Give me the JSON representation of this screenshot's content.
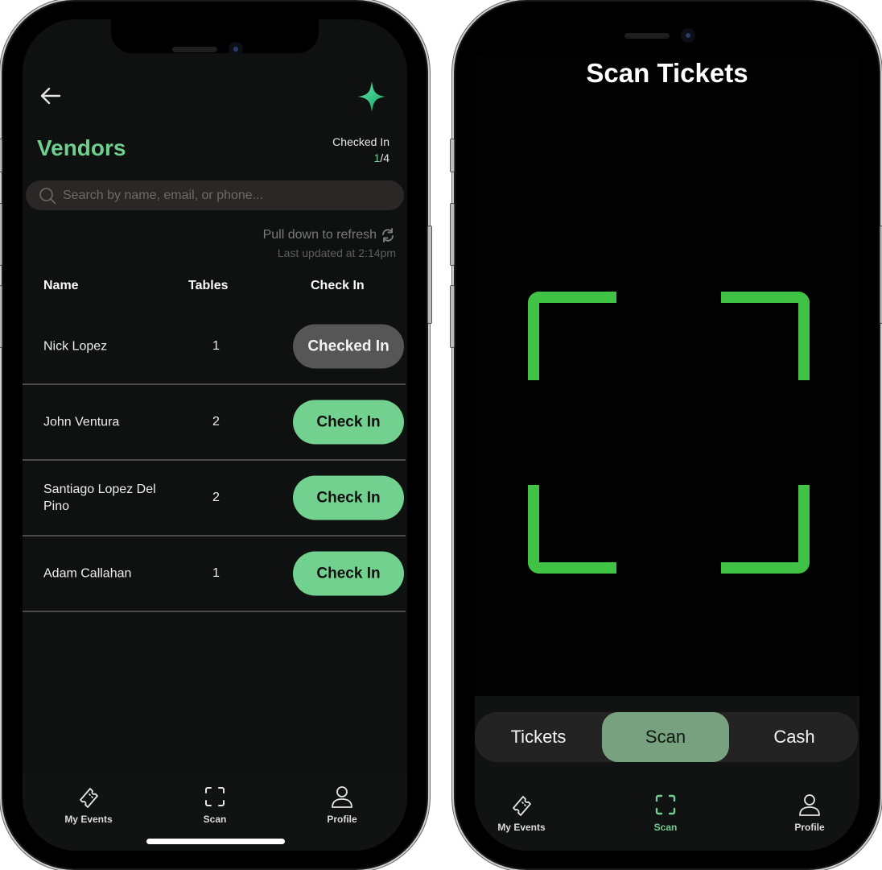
{
  "colors": {
    "accent_green": "#6fcf8f",
    "checkin_button": "#72d18e",
    "checked_in_button": "#565656",
    "scan_frame": "#40c244",
    "segment_active": "#78a17f"
  },
  "vendors_screen": {
    "back_icon": "arrow-left-icon",
    "brand_icon": "sparkle-icon",
    "title": "Vendors",
    "checked_in_label": "Checked In",
    "checked_in_count": "1",
    "checked_in_total": "/4",
    "search": {
      "placeholder": "Search by name, email, or phone...",
      "value": ""
    },
    "refresh_hint": "Pull down to refresh",
    "last_updated": "Last updated at 2:14pm",
    "table": {
      "columns": [
        "Name",
        "Tables",
        "Check In"
      ],
      "rows": [
        {
          "name": "Nick Lopez",
          "tables": "1",
          "action": "Checked In",
          "checked_in": true
        },
        {
          "name": "John Ventura",
          "tables": "2",
          "action": "Check In",
          "checked_in": false
        },
        {
          "name": "Santiago Lopez Del Pino",
          "tables": "2",
          "action": "Check In",
          "checked_in": false
        },
        {
          "name": "Adam Callahan",
          "tables": "1",
          "action": "Check In",
          "checked_in": false
        }
      ]
    },
    "tabbar": [
      {
        "label": "My Events",
        "icon": "ticket-icon",
        "active": false
      },
      {
        "label": "Scan",
        "icon": "scan-icon",
        "active": false
      },
      {
        "label": "Profile",
        "icon": "person-icon",
        "active": false
      }
    ]
  },
  "scan_screen": {
    "title": "Scan Tickets",
    "segments": [
      {
        "label": "Tickets",
        "active": false
      },
      {
        "label": "Scan",
        "active": true
      },
      {
        "label": "Cash",
        "active": false
      }
    ],
    "tabbar": [
      {
        "label": "My Events",
        "icon": "ticket-icon",
        "active": false
      },
      {
        "label": "Scan",
        "icon": "scan-icon",
        "active": true
      },
      {
        "label": "Profile",
        "icon": "person-icon",
        "active": false
      }
    ]
  }
}
